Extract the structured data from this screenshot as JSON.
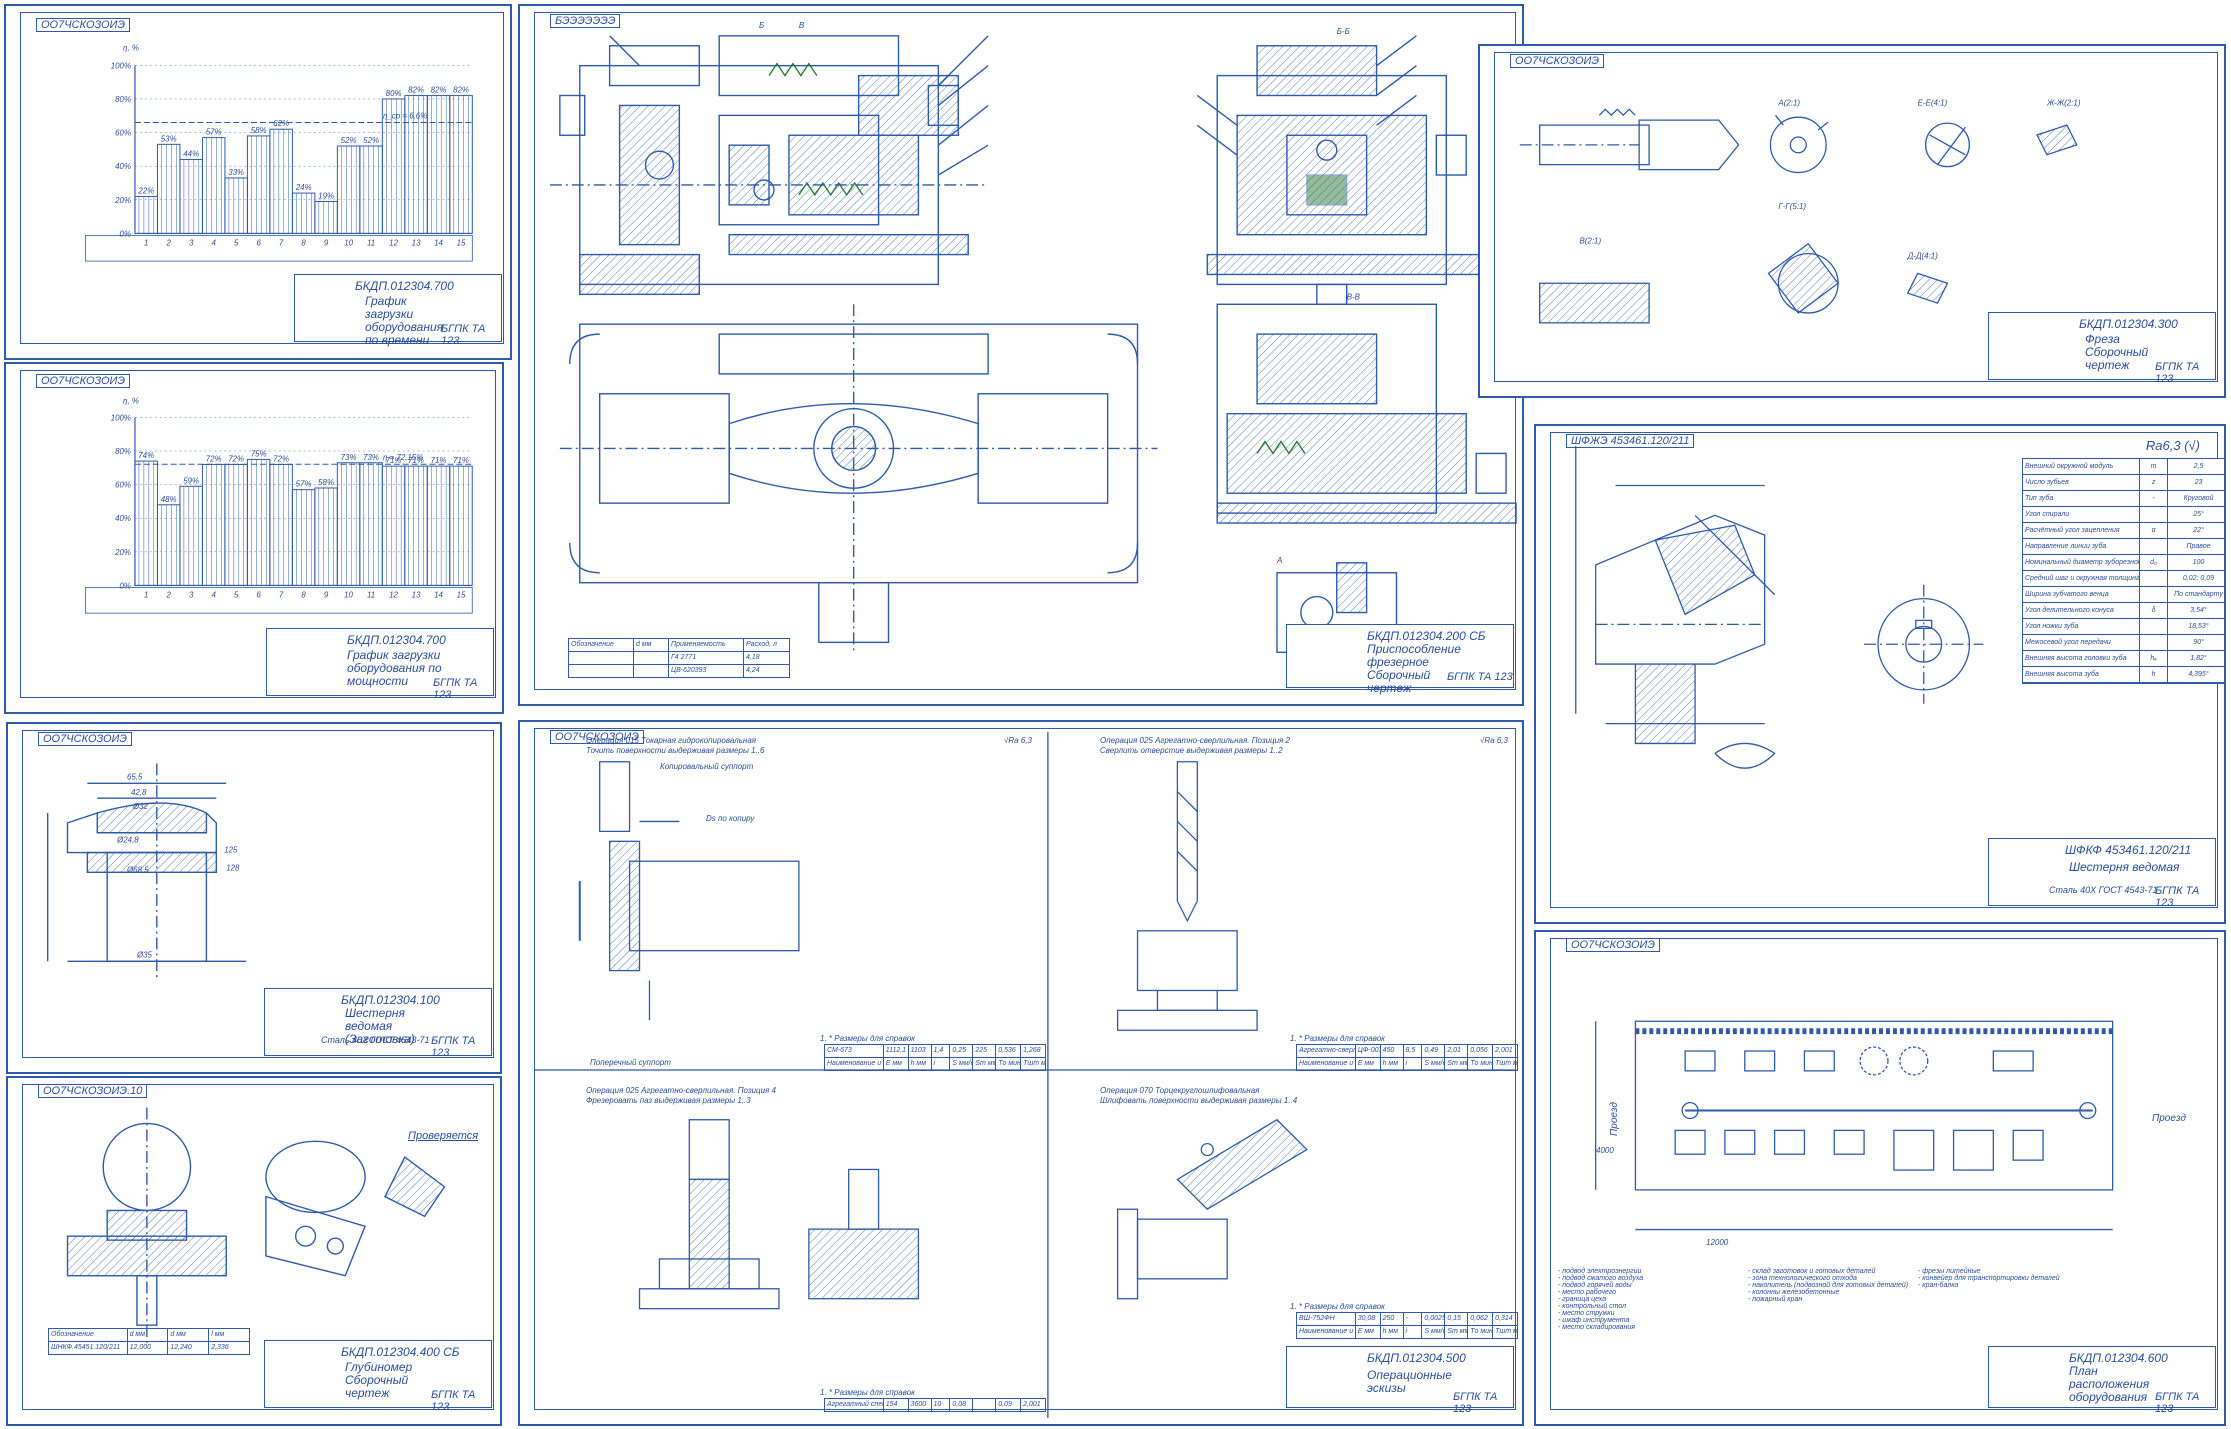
{
  "colors": {
    "line": "#2e5aa8",
    "text": "#2a4e9a",
    "hatch": "#2e5aa8",
    "accent": "#2b7a3a"
  },
  "sheets": {
    "chart_time": {
      "tag": "ОО7ЧСКОЗОИЭ",
      "code": "БКДП.012304.700",
      "name": "График загрузки оборудования по времени",
      "org": "БГПК ТА 123",
      "ylabel": "η, %",
      "mean_label": "η_ср = 6,6%"
    },
    "chart_power": {
      "tag": "ОО7ЧСКОЗОИЭ",
      "code": "БКДП.012304.700",
      "name": "График загрузки оборудования по мощности",
      "org": "БГПК ТА 123",
      "ylabel": "η, %",
      "mean_label": "η = 72,15%"
    },
    "assembly": {
      "tag": "БЭЭЭЭЭЭЭ",
      "code": "БКДП.012304.200 СБ",
      "name": "Приспособление фрезерное Сборочный чертеж",
      "org": "БГПК ТА 123",
      "view_labels": [
        "Б-Б",
        "В-В",
        "А",
        "Б",
        "В"
      ],
      "table_headers": [
        "Обозначение",
        "d мм",
        "Применяемость",
        "Расход, л"
      ],
      "table_rows": [
        [
          "",
          "",
          "Г4 2771",
          "4,18"
        ],
        [
          "",
          "",
          "ЦВ-620393",
          "4,24"
        ]
      ]
    },
    "mill": {
      "tag": "ОО7ЧСКОЗОИЭ",
      "code": "БКДП.012304.300",
      "name": "Фреза Сборочный чертеж",
      "org": "БГПК ТА 123",
      "views": [
        "А(2:1)",
        "Е-Е(4:1)",
        "Ж-Ж(2:1)",
        "Г-Г(5:1)",
        "В(2:1)",
        "Д-Д(4:1)"
      ]
    },
    "gear": {
      "tag": "ШФЖЭ 453461.120/211",
      "code": "ШФКФ 453461.120/211",
      "name": "Шестерня ведомая",
      "material": "Сталь 40Х ГОСТ 4543-71",
      "org": "БГПК ТА 123",
      "roughness": "Ra6,3 (√)",
      "params": [
        [
          "Внешний окружной модуль",
          "m",
          "2,5"
        ],
        [
          "Число зубьев",
          "z",
          "23"
        ],
        [
          "Тип зуба",
          "-",
          "Круговой"
        ],
        [
          "Угол спирали",
          "",
          "25°"
        ],
        [
          "Расчётный угол зацепления",
          "α",
          "22°"
        ],
        [
          "Направление линии зуба",
          "",
          "Правое"
        ],
        [
          "Номинальный диаметр зуборезной головки",
          "d₀",
          "100"
        ],
        [
          "Средний шаг и окружная толщина",
          "",
          "0,02; 0,09"
        ],
        [
          "Ширина зубчатого венца",
          "",
          "По стандарту"
        ],
        [
          "Угол делительного конуса",
          "δ",
          "3,54°"
        ],
        [
          "Угол ножки зуба",
          "",
          "18,53°"
        ],
        [
          "Межосевой угол передачи",
          "",
          "90°"
        ],
        [
          "Внешняя высота головки зуба",
          "hₐ",
          "1,82°"
        ],
        [
          "Внешняя высота зуба",
          "h",
          "4,395°"
        ]
      ]
    },
    "blank": {
      "tag": "ОО7ЧСКОЗОИЭ",
      "code": "БКДП.012304.100",
      "name": "Шестерня ведомая (Заготовка)",
      "material": "Сталь 40Х ГОСТ 4543-71",
      "org": "БГПК ТА 123",
      "dims": [
        "65,5",
        "42,8",
        "Ø32",
        "Ø68,5",
        "Ø35",
        "Ø24,8",
        "125",
        "128"
      ]
    },
    "gauge": {
      "tag": "ОО7ЧСКОЗОИЭ.10",
      "code": "БКДП.012304.400 СБ",
      "name": "Глубиномер Сборочный чертеж",
      "org": "БГПК ТА 123",
      "check_label": "Проверяется",
      "table_headers": [
        "Обозначение",
        "d мм",
        "d мм",
        "l мм"
      ],
      "table_rows": [
        [
          "ШНКФ.45451.120/211",
          "12,000",
          "12,240",
          "2,336"
        ]
      ]
    },
    "ops": {
      "tag": "ОО7ЧСКОЗОИЭ",
      "code": "БКДП.012304.500",
      "name": "Операционные эскизы",
      "org": "БГПК ТА 123",
      "op1": "Операция 015 Токарная гидрокопировальная\nТочить поверхности выдерживая размеры 1..6",
      "op2": "Операция 025 Агрегатно-сверлильная. Позиция 2\nСверлить отверстие выдерживая размеры 1..2",
      "op3": "Операция 025 Агрегатно-сверлильная. Позиция 4\nФрезеровать паз выдерживая размеры 1..3",
      "op4": "Операция 070 Торцекруглошлифовальная\nШлифовать поверхности выдерживая размеры 1..4",
      "roughness": "√Ra 6,3",
      "feed": "Ds по копиру",
      "support": "Копировальный суппорт",
      "support2": "Поперечный суппорт",
      "sizes_note": "1. * Размеры для справок",
      "t1_row": [
        "СМ-673",
        "1112,1",
        "1103",
        "1,4",
        "0,25",
        "225",
        "0,536",
        "1,268"
      ],
      "t2_row": [
        "Агрегатно-сверлильный",
        "ЦФ-007",
        "450",
        "8,5",
        "0,49",
        "2,01",
        "0,056",
        "2,001"
      ],
      "t3_row": [
        "Агрегатный специальный",
        "154",
        "3600",
        "10",
        "0,08",
        "",
        "0,09",
        "2,001"
      ],
      "t4_row": [
        "ВШ-752ФН",
        "30,08",
        "250",
        "-",
        "0,0025",
        "0,15",
        "0,062",
        "0,314"
      ],
      "t_head": [
        "Наименование и модель станка",
        "Е мм",
        "h мм",
        "i",
        "S мм/об",
        "Sm мм/мин",
        "Tо мин",
        "Тшт мин"
      ]
    },
    "layout": {
      "tag": "ОО7ЧСКОЗОИЭ",
      "code": "БКДП.012304.600",
      "name": "План расположения оборудования",
      "org": "БГПК ТА 123",
      "passage_left": "Проезд",
      "passage_right": "Проезд",
      "dim_top": "4000",
      "dim_bottom": "12000",
      "legend": [
        "- подвод электроэнергии",
        "- подвод сжатого воздуха",
        "- подвод горячей воды",
        "- место рабочего",
        "- граница цеха",
        "- контрольный стол",
        "- место стружки",
        "- шкаф инструмента",
        "- место складирования",
        "- склад заготовок и готовых деталей",
        "- зона технологического отхода",
        "- накопитель (подвозной для готовых деталей)",
        "- колонны железобетонные",
        "- пожарный кран",
        "- фрезы литейные",
        "- конвейер для транспортировки деталей",
        "- кран-балка"
      ]
    }
  },
  "chart_data": [
    {
      "type": "bar",
      "title": "",
      "ylabel": "η, %",
      "ylim": [
        0,
        100
      ],
      "yticks": [
        "0%",
        "20%",
        "40%",
        "60%",
        "80%",
        "100%"
      ],
      "categories": [
        "1",
        "2",
        "3",
        "4",
        "5",
        "6",
        "7",
        "8",
        "9",
        "10",
        "11",
        "12",
        "13",
        "14",
        "15"
      ],
      "values": [
        22,
        53,
        44,
        57,
        33,
        58,
        62,
        24,
        19,
        52,
        52,
        80,
        82,
        82,
        82
      ],
      "bar_labels": [
        "22%",
        "53%",
        "44%",
        "57%",
        "33%",
        "58%",
        "62%",
        "24%",
        "19%",
        "52%",
        "52%",
        "80%",
        "82%",
        "82%",
        "82%"
      ],
      "mean": 66
    },
    {
      "type": "bar",
      "title": "",
      "ylabel": "η, %",
      "ylim": [
        0,
        100
      ],
      "yticks": [
        "0%",
        "20%",
        "40%",
        "60%",
        "80%",
        "100%"
      ],
      "categories": [
        "1",
        "2",
        "3",
        "4",
        "5",
        "6",
        "7",
        "8",
        "9",
        "10",
        "11",
        "12",
        "13",
        "14",
        "15"
      ],
      "values": [
        74,
        48,
        59,
        72,
        72,
        75,
        72,
        57,
        58,
        73,
        73,
        71,
        71,
        71,
        71
      ],
      "bar_labels": [
        "74%",
        "48%",
        "59%",
        "72%",
        "72%",
        "75%",
        "72%",
        "57%",
        "58%",
        "73%",
        "73%",
        "71%",
        "71%",
        "71%",
        "71%"
      ],
      "mean": 72.15
    }
  ]
}
